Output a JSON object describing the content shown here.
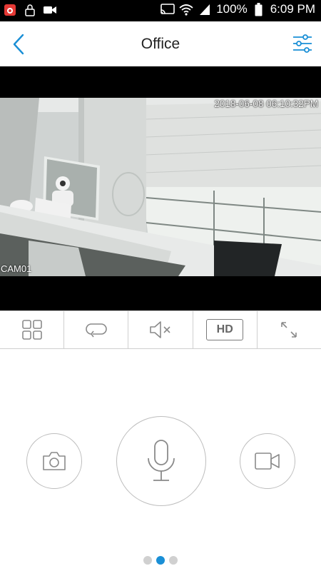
{
  "status_bar": {
    "battery": "100%",
    "time": "6:09 PM"
  },
  "header": {
    "title": "Office"
  },
  "video": {
    "timestamp": "2018-06-08 06:10:32PM",
    "camera_label": "CAM01"
  },
  "toolbar": {
    "hd_label": "HD",
    "icons": [
      "grid-icon",
      "loop-icon",
      "mute-icon",
      "hd-icon",
      "fullscreen-icon"
    ]
  },
  "actions": {
    "icons": [
      "camera-icon",
      "microphone-icon",
      "video-record-icon"
    ]
  },
  "pager": {
    "pages": 3,
    "active_page": 2
  },
  "colors": {
    "accent": "#1a8fd6",
    "icon_gray": "#8a8a8a",
    "status_bar_bg": "#000000"
  }
}
